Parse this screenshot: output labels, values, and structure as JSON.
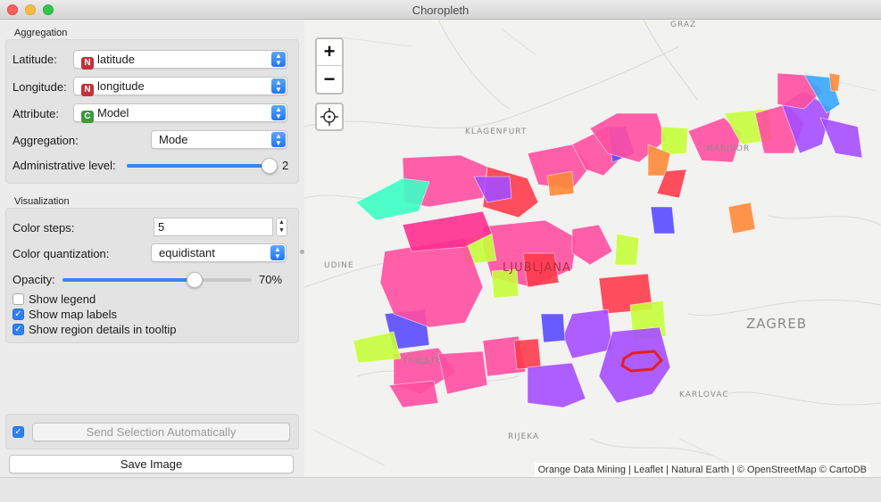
{
  "window": {
    "title": "Choropleth"
  },
  "aggregation": {
    "section_title": "Aggregation",
    "latitude_label": "Latitude:",
    "latitude_value": "latitude",
    "latitude_badge": "N",
    "longitude_label": "Longitude:",
    "longitude_value": "longitude",
    "longitude_badge": "N",
    "attribute_label": "Attribute:",
    "attribute_value": "Model",
    "attribute_badge": "C",
    "aggregation_label": "Aggregation:",
    "aggregation_value": "Mode",
    "admin_level_label": "Administrative level:",
    "admin_level_value": "2",
    "admin_level_fraction": 1.0
  },
  "visualization": {
    "section_title": "Visualization",
    "color_steps_label": "Color steps:",
    "color_steps_value": "5",
    "color_quant_label": "Color quantization:",
    "color_quant_value": "equidistant",
    "opacity_label": "Opacity:",
    "opacity_value": "70%",
    "opacity_fraction": 0.7,
    "show_legend_label": "Show legend",
    "show_legend_checked": false,
    "show_map_labels_label": "Show map labels",
    "show_map_labels_checked": true,
    "show_region_details_label": "Show region details in tooltip",
    "show_region_details_checked": true
  },
  "footer": {
    "send_auto_label": "Send Selection Automatically",
    "send_auto_checked": true,
    "save_image_label": "Save Image"
  },
  "map": {
    "zoom_in": "+",
    "zoom_out": "−",
    "attribution": "Orange Data Mining | Leaflet | Natural Earth | © OpenStreetMap © CartoDB",
    "city_labels": [
      "GRAZ",
      "KLAGENFURT",
      "MARIBOR",
      "UDINE",
      "LJUBLJANA",
      "ZAGREB",
      "TRIESTE",
      "KARLOVAC",
      "RIJEKA"
    ],
    "region_colors": [
      "#ff4fa0",
      "#a64dff",
      "#ff3b4d",
      "#5a4bff",
      "#c6ff3a",
      "#ff8a3a",
      "#3bffc4",
      "#3aa6ff",
      "#ff2f90"
    ],
    "selected_outline_color": "#e02020"
  }
}
